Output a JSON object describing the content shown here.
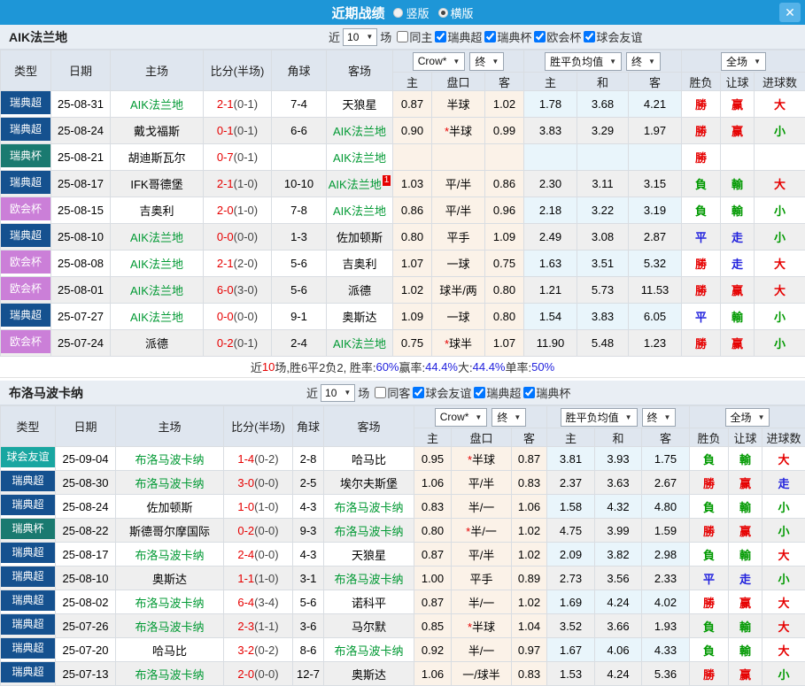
{
  "titlebar": {
    "title": "近期战绩",
    "radios": [
      {
        "label": "竖版",
        "checked": false
      },
      {
        "label": "横版",
        "checked": true
      }
    ],
    "close_label": "✕"
  },
  "icons": {
    "down": "▼"
  },
  "table_headers": {
    "type": "类型",
    "date": "日期",
    "home": "主场",
    "score": "比分(半场)",
    "corner": "角球",
    "away": "客场",
    "odds_company": "Crow*",
    "odds_stage": "终",
    "avg_label": "胜平负均值",
    "avg_stage": "终",
    "scope": "全场",
    "sub": {
      "odds_home": "主",
      "handicap": "盘口",
      "odds_away": "客",
      "avg_home": "主",
      "avg_draw": "和",
      "avg_away": "客",
      "result": "胜负",
      "handicap_result": "让球",
      "goals": "进球数"
    }
  },
  "league_colors": {
    "瑞典超": "#15518f",
    "瑞典杯": "#1a7a70",
    "欧会杯": "#cb7fd8",
    "球会友谊": "#19a6a1"
  },
  "sections": [
    {
      "team": "AIK法兰地",
      "filter": {
        "near": "近",
        "count": "10",
        "games": "场",
        "same": {
          "label": "同主",
          "checked": false
        },
        "leagues": [
          {
            "label": "瑞典超",
            "checked": true
          },
          {
            "label": "瑞典杯",
            "checked": true
          },
          {
            "label": "欧会杯",
            "checked": true
          },
          {
            "label": "球会友谊",
            "checked": true
          }
        ]
      },
      "rows": [
        {
          "league": "瑞典超",
          "date": "25-08-31",
          "home": "AIK法兰地",
          "home_link": true,
          "score": "2-1",
          "half": "(0-1)",
          "corner": "7-4",
          "away": "天狼星",
          "away_link": false,
          "away_sup": "",
          "o1": "0.87",
          "star": false,
          "hcap": "半球",
          "o2": "1.02",
          "a1": "1.78",
          "a2": "3.68",
          "a3": "4.21",
          "res": "勝",
          "res_c": "r",
          "let": "赢",
          "let_c": "r",
          "goal": "大",
          "goal_c": "r"
        },
        {
          "league": "瑞典超",
          "date": "25-08-24",
          "home": "戴戈福斯",
          "home_link": false,
          "score": "0-1",
          "half": "(0-1)",
          "corner": "6-6",
          "away": "AIK法兰地",
          "away_link": true,
          "away_sup": "",
          "o1": "0.90",
          "star": true,
          "hcap": "半球",
          "o2": "0.99",
          "a1": "3.83",
          "a2": "3.29",
          "a3": "1.97",
          "res": "勝",
          "res_c": "r",
          "let": "赢",
          "let_c": "r",
          "goal": "小",
          "goal_c": "g"
        },
        {
          "league": "瑞典杯",
          "date": "25-08-21",
          "home": "胡迪斯瓦尔",
          "home_link": false,
          "score": "0-7",
          "half": "(0-1)",
          "corner": "",
          "away": "AIK法兰地",
          "away_link": true,
          "away_sup": "",
          "o1": "",
          "star": false,
          "hcap": "",
          "o2": "",
          "a1": "",
          "a2": "",
          "a3": "",
          "res": "勝",
          "res_c": "r",
          "let": "",
          "let_c": "",
          "goal": "",
          "goal_c": ""
        },
        {
          "league": "瑞典超",
          "date": "25-08-17",
          "home": "IFK哥德堡",
          "home_link": false,
          "score": "2-1",
          "half": "(1-0)",
          "corner": "10-10",
          "away": "AIK法兰地",
          "away_link": true,
          "away_sup": "1",
          "o1": "1.03",
          "star": false,
          "hcap": "平/半",
          "o2": "0.86",
          "a1": "2.30",
          "a2": "3.11",
          "a3": "3.15",
          "res": "負",
          "res_c": "g",
          "let": "輸",
          "let_c": "g",
          "goal": "大",
          "goal_c": "r"
        },
        {
          "league": "欧会杯",
          "date": "25-08-15",
          "home": "吉奥利",
          "home_link": false,
          "score": "2-0",
          "half": "(1-0)",
          "corner": "7-8",
          "away": "AIK法兰地",
          "away_link": true,
          "away_sup": "",
          "o1": "0.86",
          "star": false,
          "hcap": "平/半",
          "o2": "0.96",
          "a1": "2.18",
          "a2": "3.22",
          "a3": "3.19",
          "res": "負",
          "res_c": "g",
          "let": "輸",
          "let_c": "g",
          "goal": "小",
          "goal_c": "g"
        },
        {
          "league": "瑞典超",
          "date": "25-08-10",
          "home": "AIK法兰地",
          "home_link": true,
          "score": "0-0",
          "half": "(0-0)",
          "corner": "1-3",
          "away": "佐加顿斯",
          "away_link": false,
          "away_sup": "",
          "o1": "0.80",
          "star": false,
          "hcap": "平手",
          "o2": "1.09",
          "a1": "2.49",
          "a2": "3.08",
          "a3": "2.87",
          "res": "平",
          "res_c": "b",
          "let": "走",
          "let_c": "b",
          "goal": "小",
          "goal_c": "g"
        },
        {
          "league": "欧会杯",
          "date": "25-08-08",
          "home": "AIK法兰地",
          "home_link": true,
          "score": "2-1",
          "half": "(2-0)",
          "corner": "5-6",
          "away": "吉奥利",
          "away_link": false,
          "away_sup": "",
          "o1": "1.07",
          "star": false,
          "hcap": "一球",
          "o2": "0.75",
          "a1": "1.63",
          "a2": "3.51",
          "a3": "5.32",
          "res": "勝",
          "res_c": "r",
          "let": "走",
          "let_c": "b",
          "goal": "大",
          "goal_c": "r"
        },
        {
          "league": "欧会杯",
          "date": "25-08-01",
          "home": "AIK法兰地",
          "home_link": true,
          "score": "6-0",
          "half": "(3-0)",
          "corner": "5-6",
          "away": "派德",
          "away_link": false,
          "away_sup": "",
          "o1": "1.02",
          "star": false,
          "hcap": "球半/两",
          "o2": "0.80",
          "a1": "1.21",
          "a2": "5.73",
          "a3": "11.53",
          "res": "勝",
          "res_c": "r",
          "let": "赢",
          "let_c": "r",
          "goal": "大",
          "goal_c": "r"
        },
        {
          "league": "瑞典超",
          "date": "25-07-27",
          "home": "AIK法兰地",
          "home_link": true,
          "score": "0-0",
          "half": "(0-0)",
          "corner": "9-1",
          "away": "奥斯达",
          "away_link": false,
          "away_sup": "",
          "o1": "1.09",
          "star": false,
          "hcap": "一球",
          "o2": "0.80",
          "a1": "1.54",
          "a2": "3.83",
          "a3": "6.05",
          "res": "平",
          "res_c": "b",
          "let": "輸",
          "let_c": "g",
          "goal": "小",
          "goal_c": "g"
        },
        {
          "league": "欧会杯",
          "date": "25-07-24",
          "home": "派德",
          "home_link": false,
          "score": "0-2",
          "half": "(0-1)",
          "corner": "2-4",
          "away": "AIK法兰地",
          "away_link": true,
          "away_sup": "",
          "o1": "0.75",
          "star": true,
          "hcap": "球半",
          "o2": "1.07",
          "a1": "11.90",
          "a2": "5.48",
          "a3": "1.23",
          "res": "勝",
          "res_c": "r",
          "let": "赢",
          "let_c": "r",
          "goal": "小",
          "goal_c": "g"
        }
      ],
      "summary": [
        {
          "t": "近"
        },
        {
          "t": "10",
          "c": "red"
        },
        {
          "t": "场,胜6平2负2, 胜率:"
        },
        {
          "t": "60%",
          "c": "blue"
        },
        {
          "t": " 赢率:"
        },
        {
          "t": "44.4%",
          "c": "blue"
        },
        {
          "t": " 大:"
        },
        {
          "t": "44.4%",
          "c": "blue"
        },
        {
          "t": " 单率:"
        },
        {
          "t": "50%",
          "c": "blue"
        }
      ]
    },
    {
      "team": "布洛马波卡纳",
      "filter": {
        "near": "近",
        "count": "10",
        "games": "场",
        "same": {
          "label": "同客",
          "checked": false
        },
        "leagues": [
          {
            "label": "球会友谊",
            "checked": true
          },
          {
            "label": "瑞典超",
            "checked": true
          },
          {
            "label": "瑞典杯",
            "checked": true
          }
        ]
      },
      "rows": [
        {
          "league": "球会友谊",
          "date": "25-09-04",
          "home": "布洛马波卡纳",
          "home_link": true,
          "score": "1-4",
          "half": "(0-2)",
          "corner": "2-8",
          "away": "哈马比",
          "away_link": false,
          "away_sup": "",
          "o1": "0.95",
          "star": true,
          "hcap": "半球",
          "o2": "0.87",
          "a1": "3.81",
          "a2": "3.93",
          "a3": "1.75",
          "res": "負",
          "res_c": "g",
          "let": "輸",
          "let_c": "g",
          "goal": "大",
          "goal_c": "r"
        },
        {
          "league": "瑞典超",
          "date": "25-08-30",
          "home": "布洛马波卡纳",
          "home_link": true,
          "score": "3-0",
          "half": "(0-0)",
          "corner": "2-5",
          "away": "埃尔夫斯堡",
          "away_link": false,
          "away_sup": "",
          "o1": "1.06",
          "star": false,
          "hcap": "平/半",
          "o2": "0.83",
          "a1": "2.37",
          "a2": "3.63",
          "a3": "2.67",
          "res": "勝",
          "res_c": "r",
          "let": "赢",
          "let_c": "r",
          "goal": "走",
          "goal_c": "b"
        },
        {
          "league": "瑞典超",
          "date": "25-08-24",
          "home": "佐加顿斯",
          "home_link": false,
          "score": "1-0",
          "half": "(1-0)",
          "corner": "4-3",
          "away": "布洛马波卡纳",
          "away_link": true,
          "away_sup": "",
          "o1": "0.83",
          "star": false,
          "hcap": "半/一",
          "o2": "1.06",
          "a1": "1.58",
          "a2": "4.32",
          "a3": "4.80",
          "res": "負",
          "res_c": "g",
          "let": "輸",
          "let_c": "g",
          "goal": "小",
          "goal_c": "g"
        },
        {
          "league": "瑞典杯",
          "date": "25-08-22",
          "home": "斯德哥尔摩国际",
          "home_link": false,
          "score": "0-2",
          "half": "(0-0)",
          "corner": "9-3",
          "away": "布洛马波卡纳",
          "away_link": true,
          "away_sup": "",
          "o1": "0.80",
          "star": true,
          "hcap": "半/一",
          "o2": "1.02",
          "a1": "4.75",
          "a2": "3.99",
          "a3": "1.59",
          "res": "勝",
          "res_c": "r",
          "let": "赢",
          "let_c": "r",
          "goal": "小",
          "goal_c": "g"
        },
        {
          "league": "瑞典超",
          "date": "25-08-17",
          "home": "布洛马波卡纳",
          "home_link": true,
          "score": "2-4",
          "half": "(0-0)",
          "corner": "4-3",
          "away": "天狼星",
          "away_link": false,
          "away_sup": "",
          "o1": "0.87",
          "star": false,
          "hcap": "平/半",
          "o2": "1.02",
          "a1": "2.09",
          "a2": "3.82",
          "a3": "2.98",
          "res": "負",
          "res_c": "g",
          "let": "輸",
          "let_c": "g",
          "goal": "大",
          "goal_c": "r"
        },
        {
          "league": "瑞典超",
          "date": "25-08-10",
          "home": "奥斯达",
          "home_link": false,
          "score": "1-1",
          "half": "(1-0)",
          "corner": "3-1",
          "away": "布洛马波卡纳",
          "away_link": true,
          "away_sup": "",
          "o1": "1.00",
          "star": false,
          "hcap": "平手",
          "o2": "0.89",
          "a1": "2.73",
          "a2": "3.56",
          "a3": "2.33",
          "res": "平",
          "res_c": "b",
          "let": "走",
          "let_c": "b",
          "goal": "小",
          "goal_c": "g"
        },
        {
          "league": "瑞典超",
          "date": "25-08-02",
          "home": "布洛马波卡纳",
          "home_link": true,
          "score": "6-4",
          "half": "(3-4)",
          "corner": "5-6",
          "away": "诺科平",
          "away_link": false,
          "away_sup": "",
          "o1": "0.87",
          "star": false,
          "hcap": "半/一",
          "o2": "1.02",
          "a1": "1.69",
          "a2": "4.24",
          "a3": "4.02",
          "res": "勝",
          "res_c": "r",
          "let": "赢",
          "let_c": "r",
          "goal": "大",
          "goal_c": "r"
        },
        {
          "league": "瑞典超",
          "date": "25-07-26",
          "home": "布洛马波卡纳",
          "home_link": true,
          "score": "2-3",
          "half": "(1-1)",
          "corner": "3-6",
          "away": "马尔默",
          "away_link": false,
          "away_sup": "",
          "o1": "0.85",
          "star": true,
          "hcap": "半球",
          "o2": "1.04",
          "a1": "3.52",
          "a2": "3.66",
          "a3": "1.93",
          "res": "負",
          "res_c": "g",
          "let": "輸",
          "let_c": "g",
          "goal": "大",
          "goal_c": "r"
        },
        {
          "league": "瑞典超",
          "date": "25-07-20",
          "home": "哈马比",
          "home_link": false,
          "score": "3-2",
          "half": "(0-2)",
          "corner": "8-6",
          "away": "布洛马波卡纳",
          "away_link": true,
          "away_sup": "",
          "o1": "0.92",
          "star": false,
          "hcap": "半/一",
          "o2": "0.97",
          "a1": "1.67",
          "a2": "4.06",
          "a3": "4.33",
          "res": "負",
          "res_c": "g",
          "let": "輸",
          "let_c": "g",
          "goal": "大",
          "goal_c": "r"
        },
        {
          "league": "瑞典超",
          "date": "25-07-13",
          "home": "布洛马波卡纳",
          "home_link": true,
          "score": "2-0",
          "half": "(0-0)",
          "corner": "12-7",
          "away": "奥斯达",
          "away_link": false,
          "away_sup": "",
          "o1": "1.06",
          "star": false,
          "hcap": "一/球半",
          "o2": "0.83",
          "a1": "1.53",
          "a2": "4.24",
          "a3": "5.36",
          "res": "勝",
          "res_c": "r",
          "let": "赢",
          "let_c": "r",
          "goal": "小",
          "goal_c": "g"
        }
      ],
      "summary": null
    }
  ]
}
